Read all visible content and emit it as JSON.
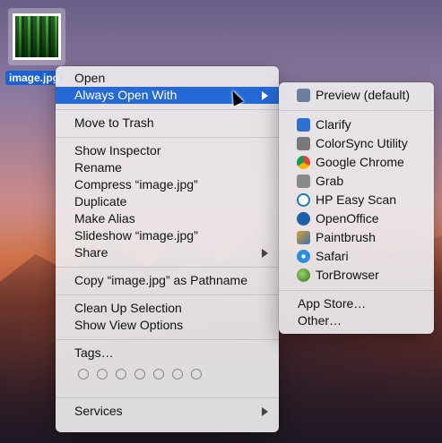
{
  "desktop": {
    "file": {
      "label": "image.jpg"
    }
  },
  "context_menu": {
    "items": [
      {
        "label": "Open"
      },
      {
        "label": "Always Open With"
      },
      {
        "label": "Move to Trash"
      },
      {
        "label": "Show Inspector"
      },
      {
        "label": "Rename"
      },
      {
        "label": "Compress “image.jpg”"
      },
      {
        "label": "Duplicate"
      },
      {
        "label": "Make Alias"
      },
      {
        "label": "Slideshow “image.jpg”"
      },
      {
        "label": "Share"
      },
      {
        "label": "Copy “image.jpg” as Pathname"
      },
      {
        "label": "Clean Up Selection"
      },
      {
        "label": "Show View Options"
      },
      {
        "label": "Tags…"
      },
      {
        "label": "Services"
      }
    ],
    "tag_colors": [
      "none",
      "none",
      "none",
      "none",
      "none",
      "none",
      "none"
    ]
  },
  "submenu": {
    "default_app": {
      "label": "Preview (default)",
      "icon": "preview-icon",
      "color": "#6a7f9e"
    },
    "apps": [
      {
        "label": "Clarify",
        "icon": "clarify-icon",
        "color": "#2f6fcf"
      },
      {
        "label": "ColorSync Utility",
        "icon": "colorsync-icon",
        "color": "#7a7a7a"
      },
      {
        "label": "Google Chrome",
        "icon": "chrome-icon",
        "color": "#db4437"
      },
      {
        "label": "Grab",
        "icon": "grab-icon",
        "color": "#8a8a8a"
      },
      {
        "label": "HP Easy Scan",
        "icon": "hp-icon",
        "color": "#1a7cc1"
      },
      {
        "label": "OpenOffice",
        "icon": "openoffice-icon",
        "color": "#1d5fa8"
      },
      {
        "label": "Paintbrush",
        "icon": "paintbrush-icon",
        "color": "#d8a030"
      },
      {
        "label": "Safari",
        "icon": "safari-icon",
        "color": "#2a8ee0"
      },
      {
        "label": "TorBrowser",
        "icon": "tor-icon",
        "color": "#5b9a3a"
      }
    ],
    "app_store": "App Store…",
    "other": "Other…"
  }
}
